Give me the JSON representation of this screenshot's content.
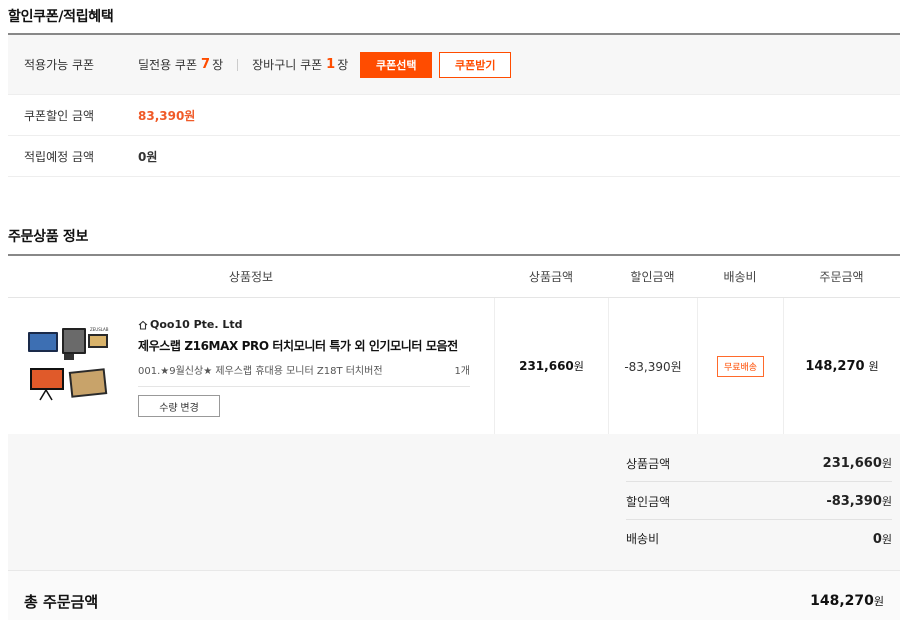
{
  "coupon_section": {
    "title": "할인쿠폰/적립혜택",
    "available_label": "적용가능 쿠폰",
    "deal_coupon_label": "딜전용 쿠폰",
    "deal_coupon_count": "7",
    "cart_coupon_label": "장바구니 쿠폰",
    "cart_coupon_count": "1",
    "count_unit": "장",
    "select_button": "쿠폰선택",
    "receive_button": "쿠폰받기",
    "discount_label": "쿠폰할인 금액",
    "discount_amount": "83,390원",
    "points_label": "적립예정 금액",
    "points_amount": "0원"
  },
  "order_section": {
    "title": "주문상품 정보",
    "headers": {
      "info": "상품정보",
      "price": "상품금액",
      "discount": "할인금액",
      "shipping": "배송비",
      "total": "주문금액"
    },
    "item": {
      "seller": "Qoo10 Pte. Ltd",
      "name": "제우스랩 Z16MAX PRO 터치모니터 특가 외 인기모니터 모음전",
      "option": "001.★9월신상★ 제우스랩 휴대용 모니터 Z18T 터치버전",
      "quantity": "1개",
      "qty_button": "수량 변경",
      "price": "231,660",
      "discount": "-83,390원",
      "shipping_badge": "무료배송",
      "total": "148,270",
      "unit": "원"
    }
  },
  "summary": {
    "product_label": "상품금액",
    "product_value": "231,660",
    "discount_label": "할인금액",
    "discount_value": "-83,390",
    "shipping_label": "배송비",
    "shipping_value": "0",
    "unit": "원",
    "grand_label": "총 주문금액",
    "grand_value": "148,270"
  },
  "colors": {
    "accent": "#ff4c00"
  }
}
